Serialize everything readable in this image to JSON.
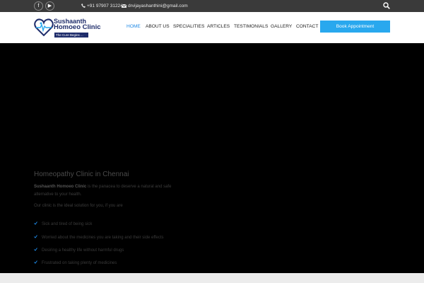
{
  "topbar": {
    "social": [
      {
        "name": "facebook",
        "glyph": "f"
      },
      {
        "name": "youtube",
        "glyph": "▶"
      }
    ],
    "phone": "+91 97907 31224",
    "email": "drvijayashanthini@gmail.com",
    "phone_icon": "phone-icon",
    "email_icon": "envelope-icon",
    "search_icon": "search-icon"
  },
  "logo": {
    "line1": "Sushaanth",
    "line2": "Homoeo Clinic",
    "tagline": "The Cure Begins ...",
    "colors": {
      "navy": "#1f2d6b",
      "accent": "#29a8ee"
    }
  },
  "nav": {
    "items": [
      "HOME",
      "ABOUT US",
      "SPECIALITIES",
      "ARTICLES",
      "TESTIMONIALS",
      "GALLERY",
      "CONTACT"
    ],
    "active": "HOME",
    "cta": "Book Appointment"
  },
  "hero": {
    "title": "Homeopathy Clinic in Chennai",
    "intro_bold": "Sushaanth Homoeo Clinic",
    "intro_rest_line1": " is the panacea to deserve a natural and safe",
    "intro_line2": "alternative to your health.",
    "sub": "Our clinic is the ideal solution for you, if you are",
    "bullets": [
      "Sick and tired of being sick",
      "Worried about the medicines you are taking and their side effects",
      "Desiring a healthy life without harmful drugs",
      "Frustrated on taking plenty of medicines"
    ],
    "check_color": "#1e88e5"
  }
}
